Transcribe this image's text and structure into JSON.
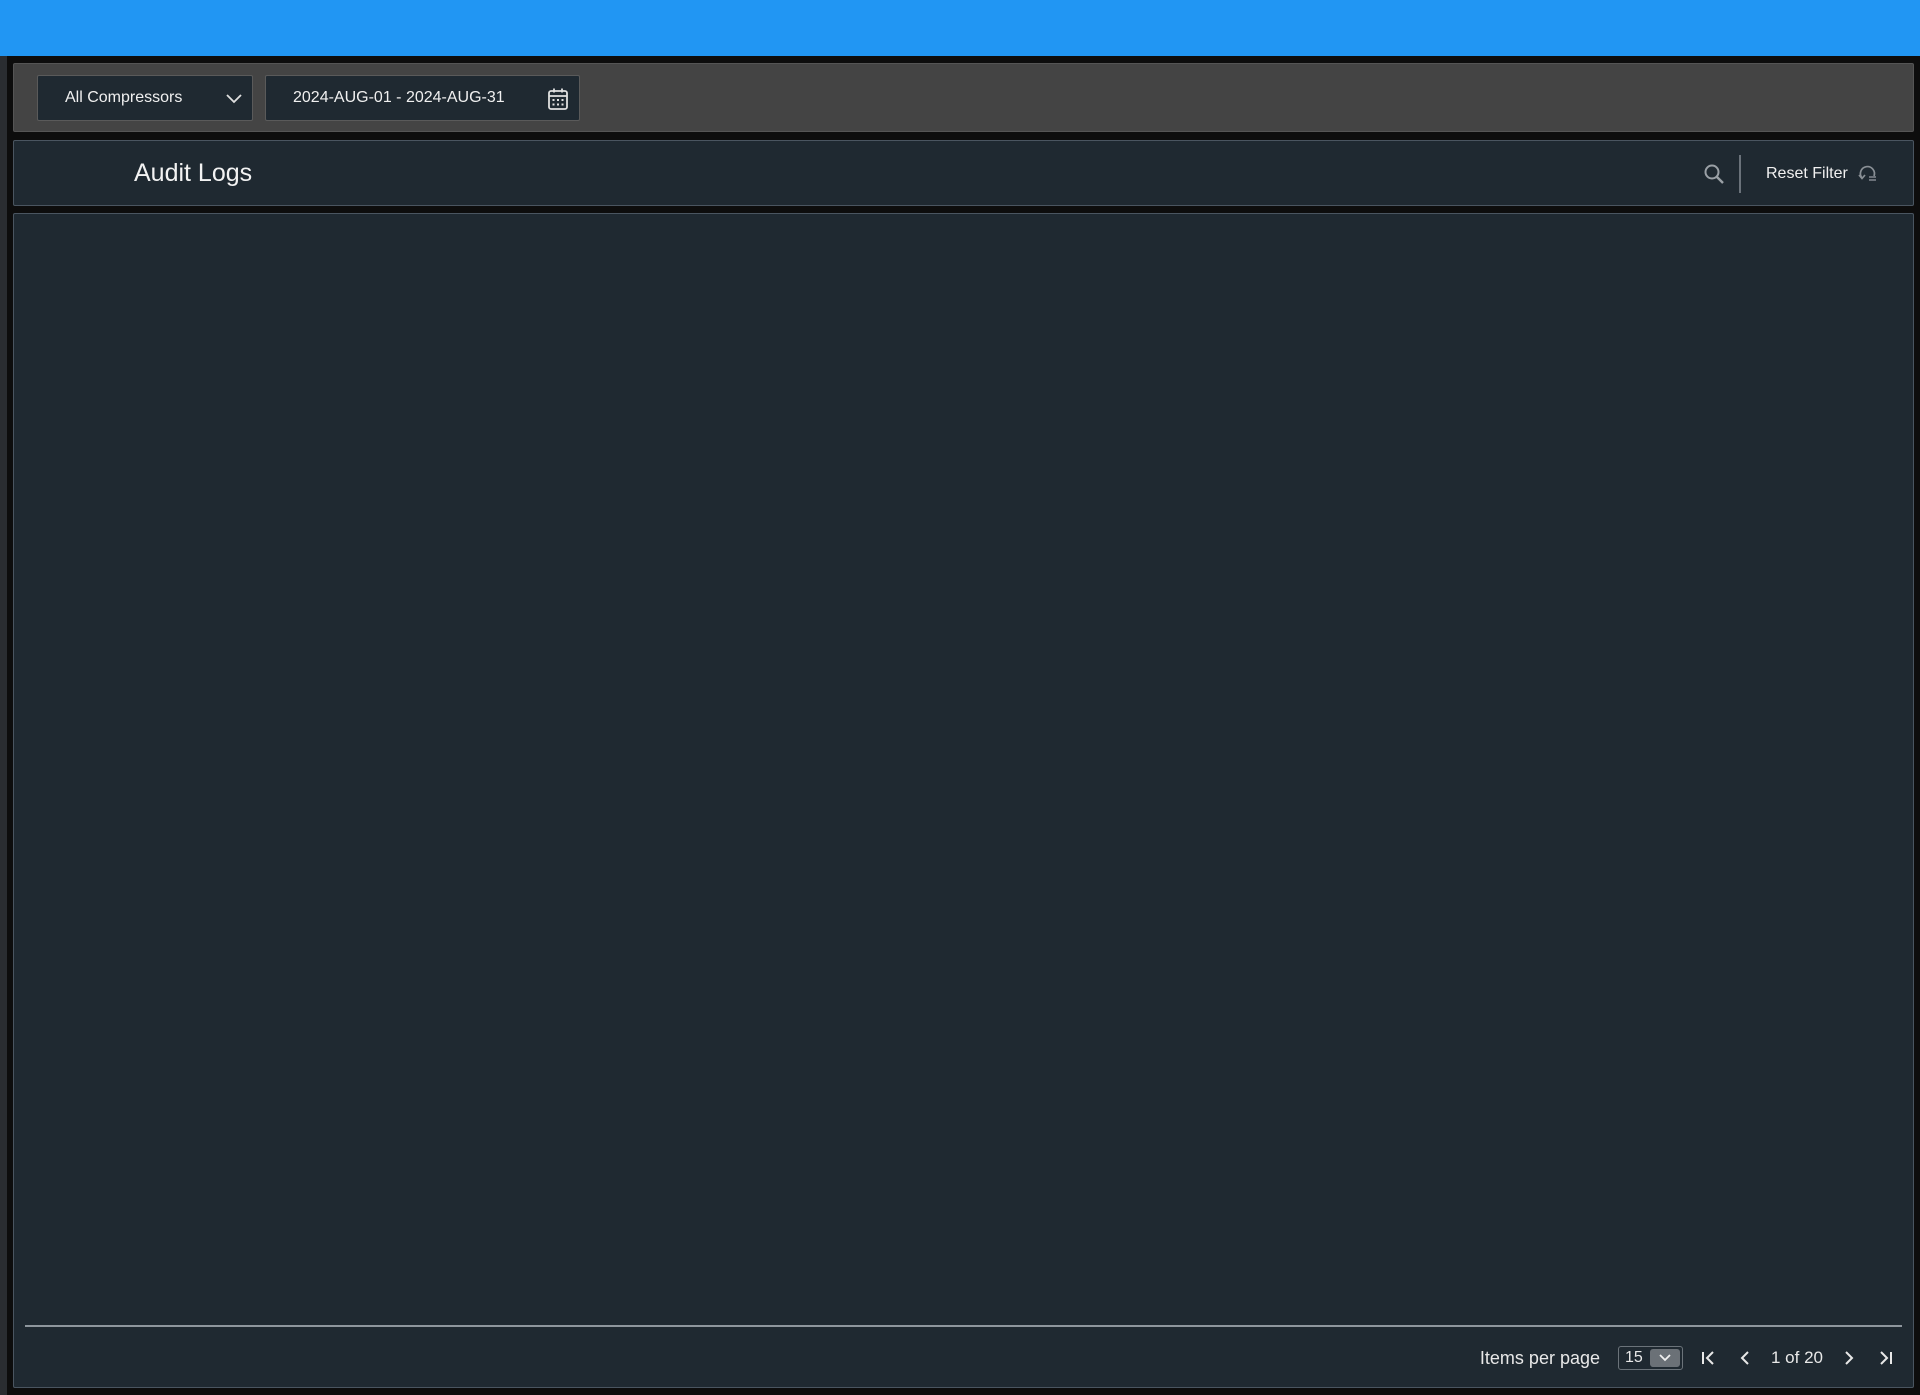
{
  "filters": {
    "compressor_select": "All Compressors",
    "date_range": "2024-AUG-01 - 2024-AUG-31"
  },
  "header": {
    "title": "Audit Logs",
    "reset_filter_label": "Reset Filter"
  },
  "pagination": {
    "items_per_page_label": "Items per page",
    "items_per_page_value": "15",
    "page_info": "1 of 20"
  },
  "colors": {
    "topbar": "#2196f3",
    "panel": "#1f2931",
    "filterbar": "#444444"
  },
  "icons": [
    "chevron-down-icon",
    "calendar-icon",
    "search-icon",
    "reset-icon",
    "first-page-icon",
    "prev-page-icon",
    "next-page-icon",
    "last-page-icon"
  ]
}
